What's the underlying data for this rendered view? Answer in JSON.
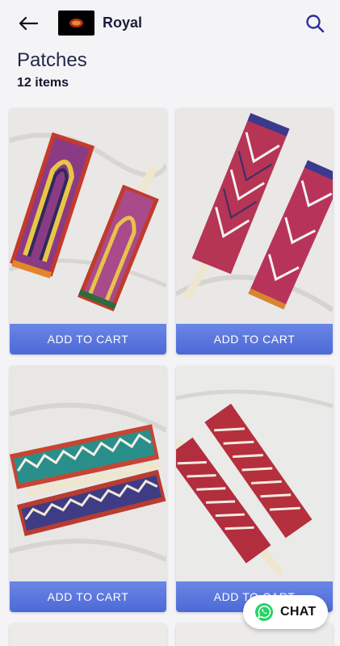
{
  "header": {
    "store_name": "Royal",
    "back_icon": "arrow-left-icon",
    "search_icon": "search-icon"
  },
  "page": {
    "title": "Patches",
    "item_count": "12 items"
  },
  "products": [
    {
      "button_label": "ADD TO CART",
      "image": "embroidered-patch-pair-1"
    },
    {
      "button_label": "ADD TO CART",
      "image": "embroidered-patch-pair-2"
    },
    {
      "button_label": "ADD TO CART",
      "image": "embroidered-patch-pair-3"
    },
    {
      "button_label": "ADD TO CART",
      "image": "embroidered-patch-pair-4"
    }
  ],
  "chat": {
    "label": "CHAT",
    "icon": "whatsapp-icon"
  },
  "colors": {
    "accent": "#5877dd",
    "title": "#1b1d3a",
    "search_icon": "#2d2f9c"
  }
}
